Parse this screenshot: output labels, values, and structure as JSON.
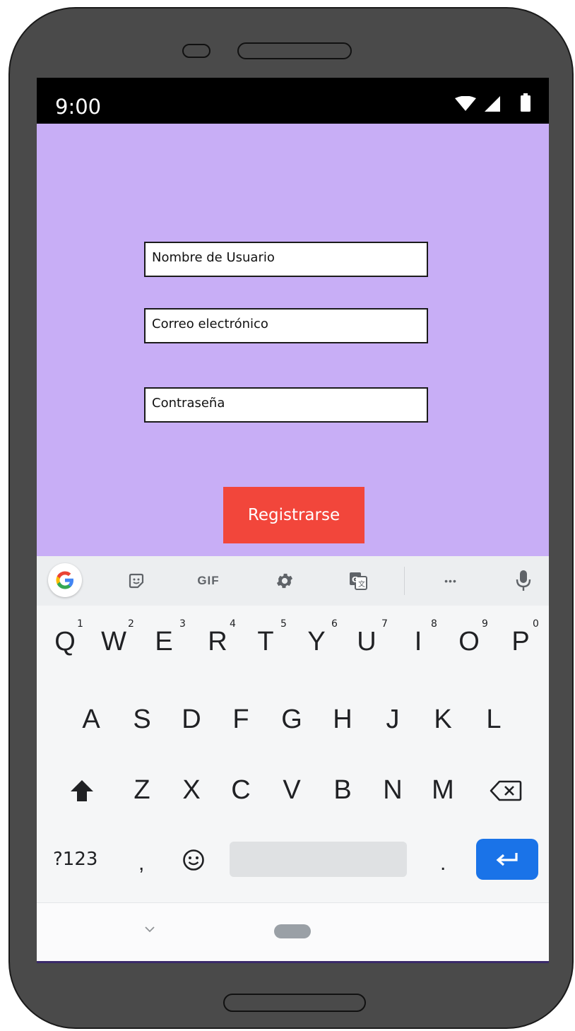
{
  "status_bar": {
    "time": "9:00",
    "icons": [
      "wifi-icon",
      "signal-icon",
      "battery-icon"
    ]
  },
  "form": {
    "username_placeholder": "Nombre de Usuario",
    "email_placeholder": "Correo electrónico",
    "password_placeholder": "Contraseña",
    "submit_label": "Registrarse"
  },
  "keyboard": {
    "toolbar": {
      "gif_label": "GIF",
      "more_label": "•••"
    },
    "row1": [
      {
        "key": "Q",
        "hint": "1"
      },
      {
        "key": "W",
        "hint": "2"
      },
      {
        "key": "E",
        "hint": "3"
      },
      {
        "key": "R",
        "hint": "4"
      },
      {
        "key": "T",
        "hint": "5"
      },
      {
        "key": "Y",
        "hint": "6"
      },
      {
        "key": "U",
        "hint": "7"
      },
      {
        "key": "I",
        "hint": "8"
      },
      {
        "key": "O",
        "hint": "9"
      },
      {
        "key": "P",
        "hint": "0"
      }
    ],
    "row2": [
      "A",
      "S",
      "D",
      "F",
      "G",
      "H",
      "J",
      "K",
      "L"
    ],
    "row3": [
      "Z",
      "X",
      "C",
      "V",
      "B",
      "N",
      "M"
    ],
    "numbers_key": "?123",
    "comma_key": ",",
    "period_key": "."
  },
  "colors": {
    "app_background": "#c8aef6",
    "button": "#f2463b",
    "enter_key": "#1a73e8",
    "phone_body": "#4a4a4a"
  }
}
